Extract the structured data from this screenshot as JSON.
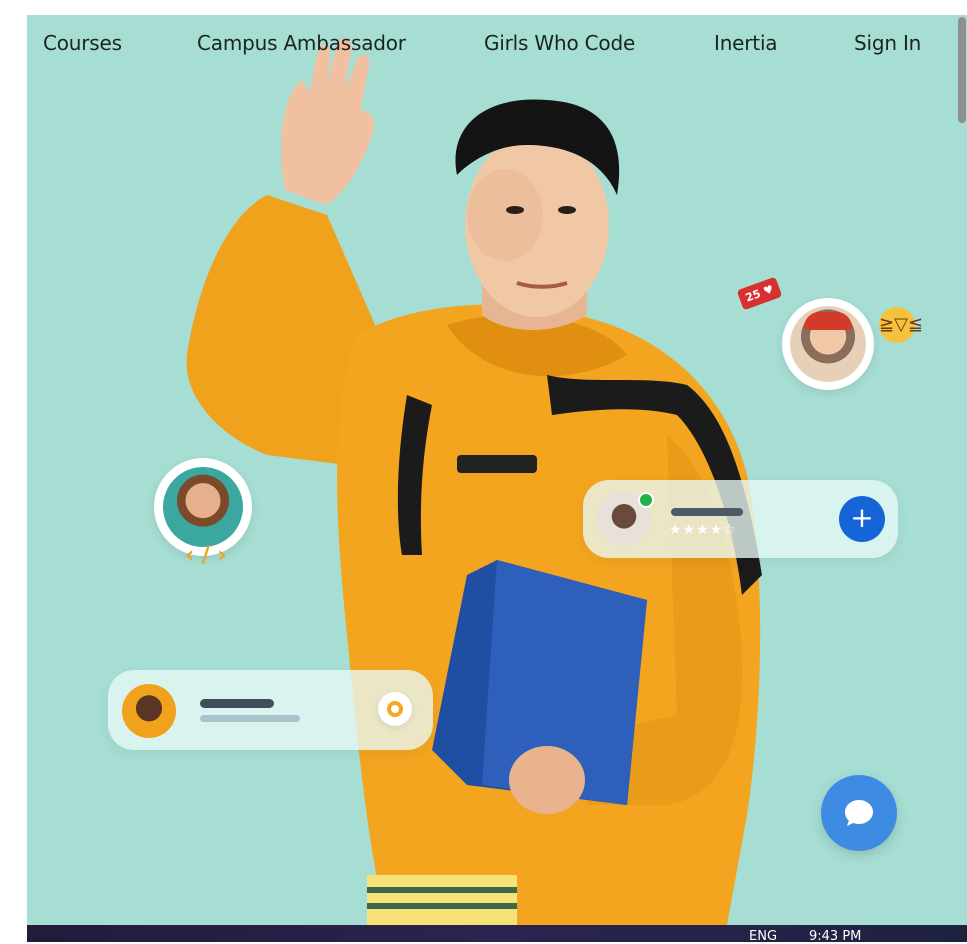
{
  "nav": {
    "items": [
      "Courses",
      "Campus Ambassador",
      "Girls Who Code",
      "Inertia",
      "Sign In"
    ]
  },
  "cards": {
    "notification_count": "25",
    "rating_stars": "★★★★☆",
    "plus_label": "+"
  },
  "taskbar": {
    "language": "ENG",
    "time": "9:43 PM"
  },
  "colors": {
    "background": "#a6ded4",
    "hoodie": "#f0a21c",
    "accent_blue": "#1565d8",
    "chat_blue": "#3d8be2"
  },
  "icons": {
    "chat": "chat-bubble-icon",
    "plus": "plus-icon",
    "heart": "heart-icon",
    "emoji": "laughing-emoji-icon",
    "online": "online-status-dot"
  }
}
